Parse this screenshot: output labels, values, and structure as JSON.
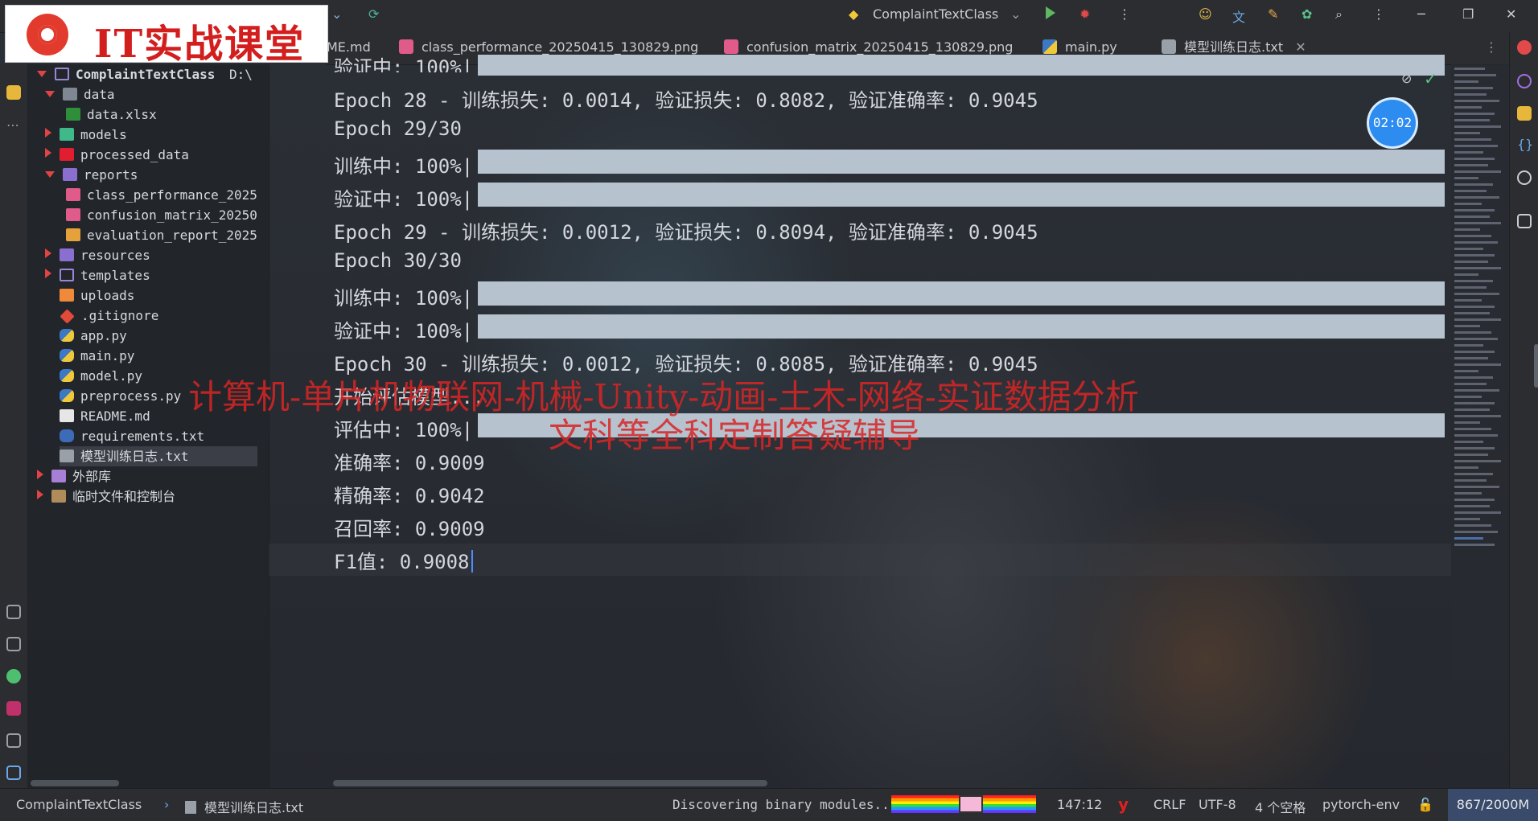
{
  "logo": {
    "text": "IT实战课堂"
  },
  "topbar": {
    "run_config": "ComplaintTextClass"
  },
  "tabs": [
    {
      "label": "ME.md",
      "icon": "markdown-icon"
    },
    {
      "label": "class_performance_20250415_130829.png",
      "icon": "image-icon"
    },
    {
      "label": "confusion_matrix_20250415_130829.png",
      "icon": "image-icon"
    },
    {
      "label": "main.py",
      "icon": "python-icon"
    },
    {
      "label": "模型训练日志.txt",
      "icon": "text-file-icon",
      "active": true
    }
  ],
  "tree": {
    "root": "ComplaintTextClass",
    "root_path": "D:\\",
    "items": [
      {
        "label": "data"
      },
      {
        "label": "data.xlsx"
      },
      {
        "label": "models"
      },
      {
        "label": "processed_data"
      },
      {
        "label": "reports"
      },
      {
        "label": "class_performance_2025"
      },
      {
        "label": "confusion_matrix_20250"
      },
      {
        "label": "evaluation_report_2025"
      },
      {
        "label": "resources"
      },
      {
        "label": "templates"
      },
      {
        "label": "uploads"
      },
      {
        "label": ".gitignore"
      },
      {
        "label": "app.py"
      },
      {
        "label": "main.py"
      },
      {
        "label": "model.py"
      },
      {
        "label": "preprocess.py"
      },
      {
        "label": "README.md"
      },
      {
        "label": "requirements.txt"
      },
      {
        "label": "模型训练日志.txt"
      },
      {
        "label": "外部库"
      },
      {
        "label": "临时文件和控制台"
      }
    ]
  },
  "editor": {
    "lines": [
      "验证中: 100%|",
      "Epoch 28 - 训练损失: 0.0014, 验证损失: 0.8082, 验证准确率: 0.9045",
      "Epoch 29/30",
      "训练中: 100%|",
      "验证中: 100%|",
      "Epoch 29 - 训练损失: 0.0012, 验证损失: 0.8094, 验证准确率: 0.9045",
      "Epoch 30/30",
      "训练中: 100%|",
      "验证中: 100%|",
      "Epoch 30 - 训练损失: 0.0012, 验证损失: 0.8085, 验证准确率: 0.9045",
      "开始评估模型...",
      "评估中: 100%|",
      "准确率: 0.9009",
      "精确率: 0.9042",
      "召回率: 0.9009",
      "F1值: 0.9008"
    ]
  },
  "timer": "02:02",
  "watermark": {
    "line1": "计算机-单片机物联网-机械-Unity-动画-土木-网络-实证数据分析",
    "line2": "文科等全科定制答疑辅导"
  },
  "statusbar": {
    "breadcrumb_project": "ComplaintTextClass",
    "breadcrumb_file": "模型训练日志.txt",
    "task": "Discovering binary modules...",
    "position": "147:12",
    "line_ending": "CRLF",
    "encoding": "UTF-8",
    "indent": "4 个空格",
    "interpreter": "pytorch-env",
    "memory": "867/2000M"
  },
  "colors": {
    "accent": "#3574f0",
    "watermark": "#d92525",
    "progress_bar": "#b6c2ce"
  }
}
